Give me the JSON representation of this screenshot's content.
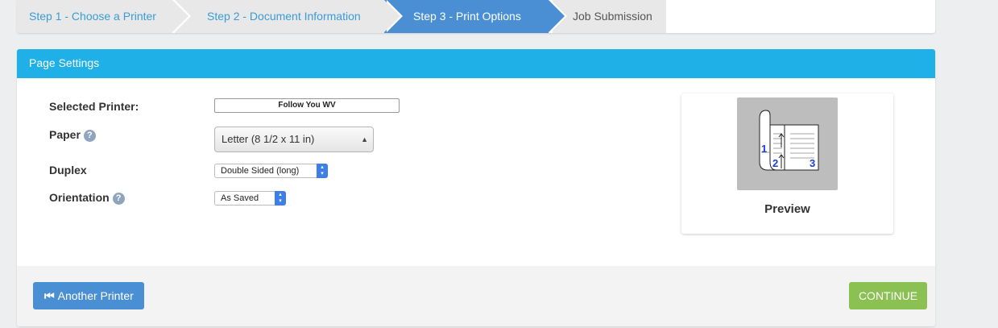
{
  "wizard": {
    "steps": [
      {
        "label": "Step 1 - Choose a Printer"
      },
      {
        "label": "Step 2 - Document Information"
      },
      {
        "label": "Step 3 - Print Options"
      },
      {
        "label": "Job Submission"
      }
    ]
  },
  "panel": {
    "title": "Page Settings",
    "fields": {
      "selected_printer_label": "Selected Printer:",
      "selected_printer_value": "Follow You WV",
      "paper_label": "Paper",
      "paper_value": "Letter (8 1/2 x 11 in)",
      "duplex_label": "Duplex",
      "duplex_value": "Double Sided (long)",
      "orientation_label": "Orientation",
      "orientation_value": "As Saved"
    },
    "preview": {
      "label": "Preview",
      "page_numbers": [
        "1",
        "2",
        "3"
      ]
    }
  },
  "footer": {
    "another_printer_label": "Another Printer",
    "continue_label": "CONTINUE"
  },
  "colors": {
    "header": "#1fb0e8",
    "active_step": "#4a8fd4",
    "continue": "#8bc152",
    "link": "#3a9bd5"
  }
}
